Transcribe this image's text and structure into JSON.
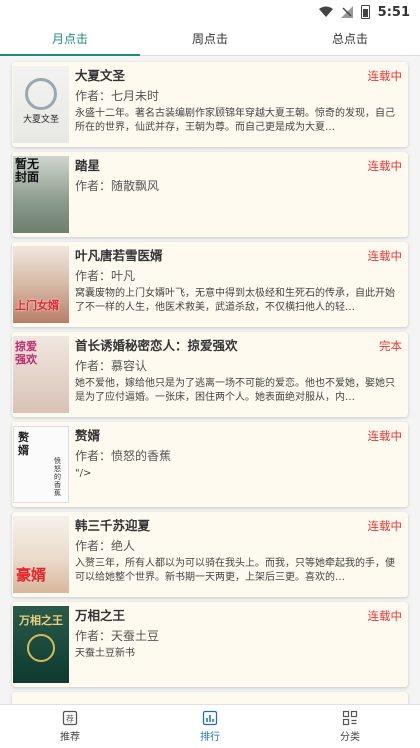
{
  "status_bar": {
    "time": "5:51"
  },
  "tabs": [
    {
      "label": "月点击"
    },
    {
      "label": "周点击"
    },
    {
      "label": "总点击"
    }
  ],
  "books": [
    {
      "title": "大夏文圣",
      "author": "作者：七月未时",
      "status": "连载中",
      "desc": "永盛十二年。著名古装编剧作家顾锦年穿越大夏王朝。惊奇的发现，自己所在的世界，仙武并存，王朝为尊。而自己更是成为大夏…",
      "cover_title": "大夏文圣"
    },
    {
      "title": "踏星",
      "author": "作者：随散飘风",
      "status": "连载中",
      "desc": "",
      "cover_title": "暂无封面"
    },
    {
      "title": "叶凡唐若雪医婿",
      "author": "作者：叶凡",
      "status": "连载中",
      "desc": "窝囊废物的上门女婿叶飞，无意中得到太极经和生死石的传承，自此开始了不一样的人生，他医术救美，武道杀敌，不仅横扫他人的轻…",
      "cover_title": "上门女婿"
    },
    {
      "title": "首长诱婚秘密恋人：掠爱强欢",
      "author": "作者：慕容认",
      "status": "完本",
      "desc": "她不爱他，嫁给他只是为了逃离一场不可能的爱恋。他也不爱她，娶她只是为了应付逼婚。一张床，困住两个人。她表面绝对服从，内…",
      "cover_title": "掠爱强欢"
    },
    {
      "title": "赘婿",
      "author": "作者：愤怒的香蕉",
      "status": "连载中",
      "desc": "\"/>",
      "cover_title": "赘婿",
      "cover_sub": "愤怒的香蕉"
    },
    {
      "title": "韩三千苏迎夏",
      "author": "作者：绝人",
      "status": "连载中",
      "desc": "入赘三年，所有人都以为可以骑在我头上。而我，只等她牵起我的手，便可以给她整个世界。新书期一天两更，上架后三更。喜欢的…",
      "cover_title": "豪婿"
    },
    {
      "title": "万相之王",
      "author": "作者：天蚕土豆",
      "status": "连载中",
      "desc": "天蚕土豆新书",
      "cover_title": "万相之王"
    }
  ],
  "bottom_nav": [
    {
      "label": "推荐",
      "icon": "recommend-icon"
    },
    {
      "label": "排行",
      "icon": "ranking-icon"
    },
    {
      "label": "分类",
      "icon": "category-icon"
    }
  ],
  "colors": {
    "accent": "#1e8c7a",
    "status_red": "#e53935",
    "nav_active": "#1e6fb8",
    "card_bg": "#fffaf0"
  }
}
